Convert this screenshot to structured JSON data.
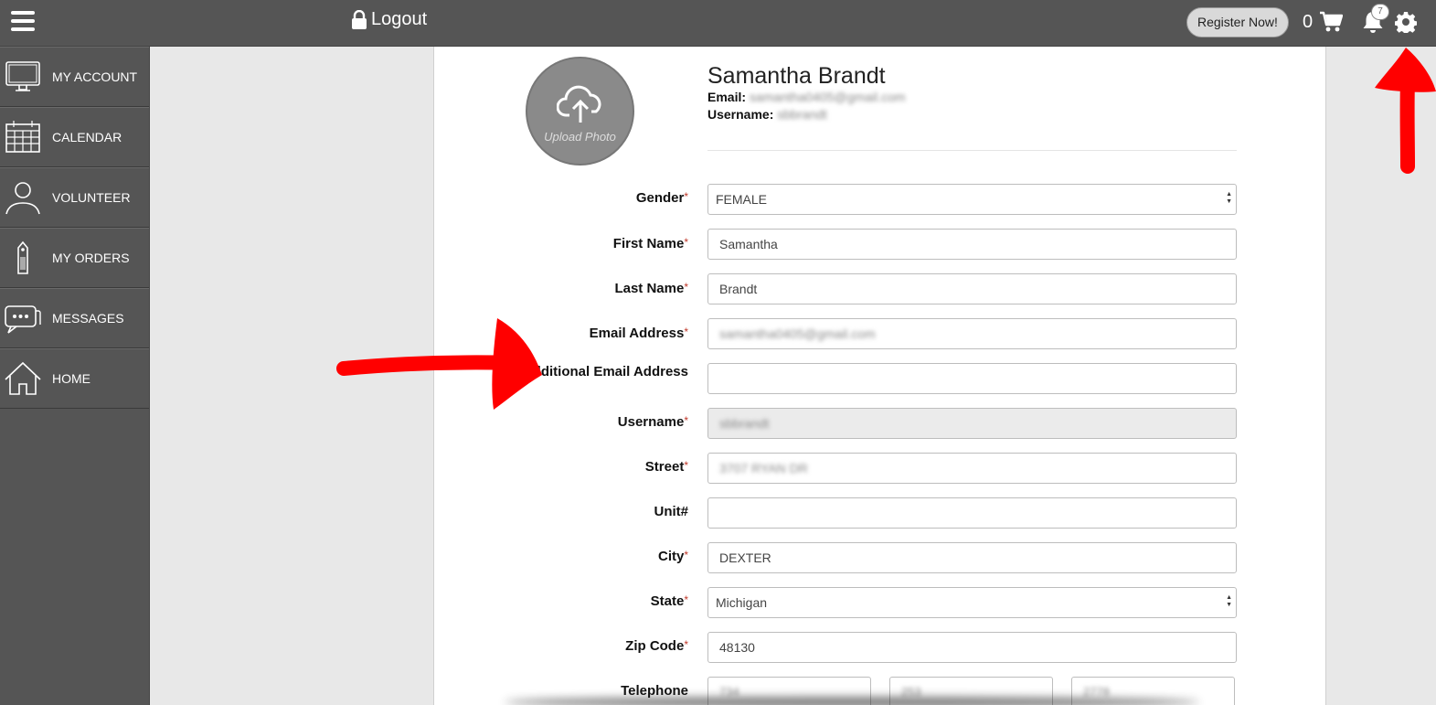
{
  "header": {
    "logout_label": "Logout",
    "register_label": "Register Now!",
    "cart_count": "0",
    "notification_count": "7"
  },
  "sidebar": {
    "items": [
      {
        "label": "MY ACCOUNT",
        "icon": "monitor-icon"
      },
      {
        "label": "CALENDAR",
        "icon": "calendar-icon"
      },
      {
        "label": "VOLUNTEER",
        "icon": "person-icon"
      },
      {
        "label": "MY ORDERS",
        "icon": "tag-icon"
      },
      {
        "label": "MESSAGES",
        "icon": "chat-icon"
      },
      {
        "label": "HOME",
        "icon": "home-icon"
      }
    ]
  },
  "profile": {
    "upload_label": "Upload Photo",
    "name": "Samantha Brandt",
    "email_label": "Email:",
    "email_value": "samantha0405@gmail.com",
    "username_label": "Username:",
    "username_value": "sbbrandt"
  },
  "form": {
    "gender": {
      "label": "Gender",
      "value": "FEMALE"
    },
    "first_name": {
      "label": "First Name",
      "value": "Samantha"
    },
    "last_name": {
      "label": "Last Name",
      "value": "Brandt"
    },
    "email": {
      "label": "Email Address",
      "value": "samantha0405@gmail.com"
    },
    "additional_email": {
      "label": "Additional Email Address",
      "value": ""
    },
    "username": {
      "label": "Username",
      "value": "sbbrandt"
    },
    "street": {
      "label": "Street",
      "value": "3707 RYAN DR"
    },
    "unit": {
      "label": "Unit#",
      "value": ""
    },
    "city": {
      "label": "City",
      "value": "DEXTER"
    },
    "state": {
      "label": "State",
      "value": "Michigan"
    },
    "zip": {
      "label": "Zip Code",
      "value": "48130"
    },
    "telephone": {
      "label": "Telephone",
      "area": "734",
      "prefix": "253",
      "line": "2778"
    },
    "required_mark": "*"
  },
  "colors": {
    "topbar": "#555555",
    "annotation": "#ff0000"
  }
}
